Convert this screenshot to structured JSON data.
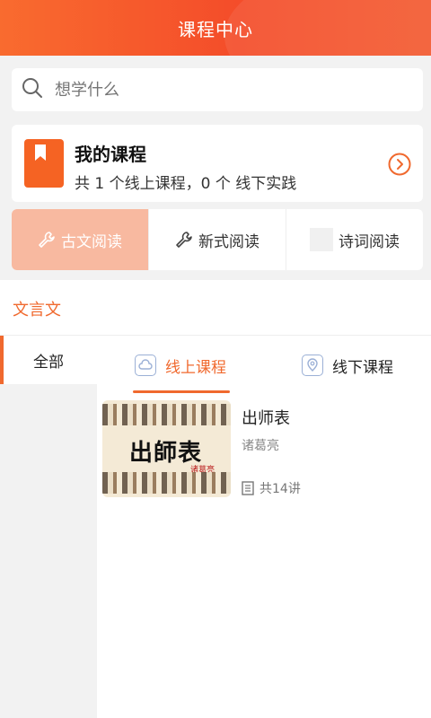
{
  "header": {
    "title": "课程中心"
  },
  "search": {
    "placeholder": "想学什么"
  },
  "my_course": {
    "title": "我的课程",
    "summary": "共 1 个线上课程，0 个 线下实践"
  },
  "categories": [
    {
      "label": "古文阅读",
      "icon": "wrench-icon",
      "active": true
    },
    {
      "label": "新式阅读",
      "icon": "wrench-icon",
      "active": false
    },
    {
      "label": "诗词阅读",
      "icon": "image-placeholder-icon",
      "active": false
    }
  ],
  "section": {
    "label": "文言文"
  },
  "sidebar": {
    "items": [
      {
        "label": "全部"
      }
    ]
  },
  "tabs": [
    {
      "label": "线上课程",
      "icon": "cloud-icon",
      "active": true
    },
    {
      "label": "线下课程",
      "icon": "location-icon",
      "active": false
    }
  ],
  "courses": [
    {
      "thumb_title": "出師表",
      "thumb_author": "诸葛亮",
      "name": "出师表",
      "author": "诸葛亮",
      "lessons": "共14讲"
    }
  ],
  "colors": {
    "accent": "#f0692e",
    "header": "#f44d2a",
    "active_category": "#f8b9a0"
  }
}
